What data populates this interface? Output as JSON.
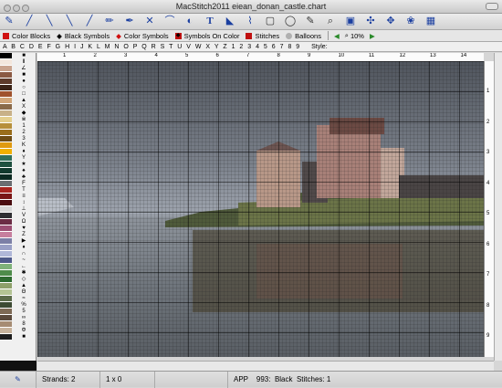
{
  "window": {
    "title": "MacStitch2011  eiean_donan_castle.chart"
  },
  "toolbar_main": {
    "icons": [
      "needle-icon",
      "needle-dropdown-icon",
      "half-stitch-icon",
      "quarter-stitch-icon",
      "backstitch-icon",
      "three-quarter-icon",
      "french-knot-icon",
      "bead-icon",
      "line-icon",
      "fill-icon",
      "dropdown-icon",
      "text-icon",
      "chart-icon",
      "paint-icon",
      "paint-dropdown-icon",
      "select-rect-icon",
      "lasso-icon",
      "pencil-icon",
      "zoom-icon",
      "symbol-icon",
      "puzzle-icon",
      "move-icon",
      "flower-icon",
      "grid-icon"
    ]
  },
  "toolbar_view": {
    "color_blocks": "Color Blocks",
    "black_symbols": "Black Symbols",
    "color_symbols": "Color Symbols",
    "symbols_on_color": "Symbols On Color",
    "stitches": "Stitches",
    "balloons": "Balloons",
    "zoom": "10%",
    "colors": {
      "color_blocks": "#d01010",
      "black_symbols": "#000000",
      "color_symbols": "#d01010",
      "symbols_on_color": "#c01010",
      "stitches": "#c01010",
      "balloons": "#b0b0b0"
    }
  },
  "letters_bar": {
    "chars": "A B C D E F G H I J K L M N O P Q R S T U V W X Y Z 1 2 3 4 5 6 7 8 9",
    "style_label": "Style:"
  },
  "ruler": {
    "top": [
      "1",
      "2",
      "3",
      "4",
      "5",
      "6",
      "7",
      "8",
      "9",
      "10",
      "11",
      "12",
      "13",
      "14"
    ],
    "side": [
      "1",
      "2",
      "3",
      "4",
      "5",
      "6",
      "7",
      "8",
      "9"
    ]
  },
  "palette": [
    {
      "color": "#000000",
      "symbol": "■"
    },
    {
      "color": "#f3e7dd",
      "symbol": "Ⅱ"
    },
    {
      "color": "#c9a38d",
      "symbol": "∠"
    },
    {
      "color": "#8b5a43",
      "symbol": "■"
    },
    {
      "color": "#5e3b2b",
      "symbol": "●"
    },
    {
      "color": "#3b2418",
      "symbol": "○"
    },
    {
      "color": "#a0522d",
      "symbol": "□"
    },
    {
      "color": "#d2a679",
      "symbol": "▲"
    },
    {
      "color": "#8b6b4a",
      "symbol": "X"
    },
    {
      "color": "#c8b188",
      "symbol": "◆"
    },
    {
      "color": "#e4cf8e",
      "symbol": "※"
    },
    {
      "color": "#b7903b",
      "symbol": "1"
    },
    {
      "color": "#9a6e1b",
      "symbol": "2"
    },
    {
      "color": "#6e4c15",
      "symbol": "3"
    },
    {
      "color": "#e09a10",
      "symbol": "K"
    },
    {
      "color": "#f0b000",
      "symbol": "♦"
    },
    {
      "color": "#2f6f5a",
      "symbol": "Y"
    },
    {
      "color": "#1f5140",
      "symbol": "★"
    },
    {
      "color": "#123a2e",
      "symbol": "♠"
    },
    {
      "color": "#0b2a22",
      "symbol": "♣"
    },
    {
      "color": "#6b6e72",
      "symbol": "F"
    },
    {
      "color": "#a8241f",
      "symbol": "T"
    },
    {
      "color": "#7a1616",
      "symbol": "≡"
    },
    {
      "color": "#4a0c10",
      "symbol": "↕"
    },
    {
      "color": "#d8d8d8",
      "symbol": "⊥"
    },
    {
      "color": "#2f2f33",
      "symbol": "V"
    },
    {
      "color": "#6b2c44",
      "symbol": "Ω"
    },
    {
      "color": "#9c4f74",
      "symbol": "♥"
    },
    {
      "color": "#c77f9e",
      "symbol": "Z"
    },
    {
      "color": "#7c7fa6",
      "symbol": "▶"
    },
    {
      "color": "#9aa0c6",
      "symbol": "♦"
    },
    {
      "color": "#b0b7d8",
      "symbol": "∩"
    },
    {
      "color": "#4f5a8a",
      "symbol": "~"
    },
    {
      "color": "#7fb27a",
      "symbol": "←"
    },
    {
      "color": "#4e8c4a",
      "symbol": "✱"
    },
    {
      "color": "#2e6b30",
      "symbol": "◇"
    },
    {
      "color": "#8ea06a",
      "symbol": "▲"
    },
    {
      "color": "#b4c494",
      "symbol": "Θ"
    },
    {
      "color": "#5c6b4a",
      "symbol": "≈"
    },
    {
      "color": "#3d4a33",
      "symbol": "%"
    },
    {
      "color": "#7e6a55",
      "symbol": "5"
    },
    {
      "color": "#5b4a3c",
      "symbol": "∞"
    },
    {
      "color": "#a68c73",
      "symbol": "8"
    },
    {
      "color": "#c7b39c",
      "symbol": "Φ"
    },
    {
      "color": "#1d1d1d",
      "symbol": "■"
    }
  ],
  "status": {
    "strands_label": "Strands:",
    "strands_value": "2",
    "size": "1 x 0",
    "brand": "APP",
    "code": "993:",
    "color_name": "Black",
    "stitches_label": "Stitches:",
    "stitches_value": "1"
  }
}
